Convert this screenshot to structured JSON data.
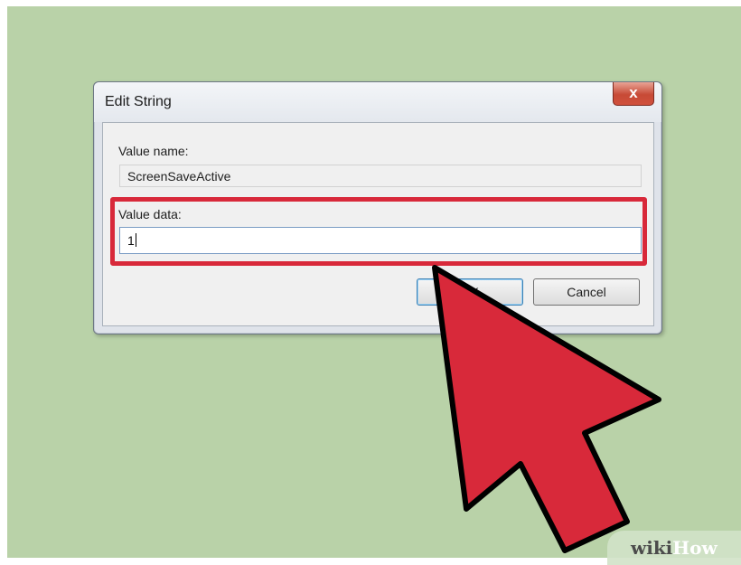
{
  "dialog": {
    "title": "Edit String",
    "close_glyph": "x",
    "value_name_label": "Value name:",
    "value_name": "ScreenSaveActive",
    "value_data_label": "Value data:",
    "value_data": "1",
    "ok_label": "OK",
    "cancel_label": "Cancel"
  },
  "overlay": {
    "highlight_color": "#d8293a",
    "arrow_color": "#d8293a",
    "arrow_icon": "pointer-arrow-icon"
  },
  "watermark": {
    "part1": "wiki",
    "part2": "How"
  },
  "colors": {
    "background": "#b9d2a8"
  }
}
